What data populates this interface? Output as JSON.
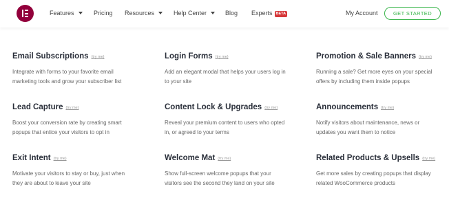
{
  "nav": {
    "items": [
      {
        "label": "Features"
      },
      {
        "label": "Pricing"
      },
      {
        "label": "Resources"
      },
      {
        "label": "Help Center"
      },
      {
        "label": "Blog"
      },
      {
        "label": "Experts",
        "badge": "BETA"
      }
    ],
    "account_label": "My Account",
    "cta_label": "GET STARTED"
  },
  "brand": {
    "logo_color": "#92003b",
    "accent_color": "#39b54a",
    "badge_color": "#d63638"
  },
  "try_label": "(try me)",
  "cards": [
    {
      "title": "Email Subscriptions",
      "desc": [
        "Integrate with forms to your favorite email",
        "marketing tools and grow your subscriber list"
      ]
    },
    {
      "title": "Login Forms",
      "desc": [
        "Add an elegant modal that helps your users log in",
        "to your site"
      ]
    },
    {
      "title": "Promotion & Sale Banners",
      "desc": [
        "Running a sale? Get more eyes on your special",
        "offers by including them inside popups"
      ]
    },
    {
      "title": "Lead Capture",
      "desc": [
        "Boost your conversion rate by creating smart",
        "popups that entice your visitors to opt in"
      ]
    },
    {
      "title": "Content Lock & Upgrades",
      "desc": [
        "Reveal your premium content to users who opted",
        "in, or agreed to your terms"
      ]
    },
    {
      "title": "Announcements",
      "desc": [
        "Notify visitors about maintenance, news or",
        "updates you want them to notice"
      ]
    },
    {
      "title": "Exit Intent",
      "desc": [
        "Motivate your visitors to stay or buy, just when",
        "they are about to leave your site"
      ]
    },
    {
      "title": "Welcome Mat",
      "desc": [
        "Show full-screen welcome popups that your",
        "visitors see the second they land on your site"
      ]
    },
    {
      "title": "Related Products & Upsells",
      "desc": [
        "Get more sales by creating popups that display",
        "related WooCommerce products"
      ]
    }
  ]
}
